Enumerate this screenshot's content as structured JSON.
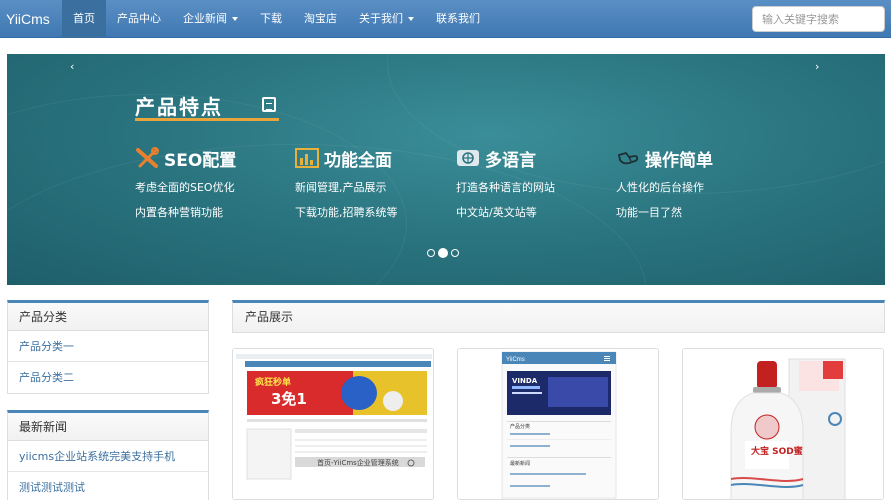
{
  "brand": "YiiCms",
  "nav": {
    "items": [
      {
        "label": "首页"
      },
      {
        "label": "产品中心"
      },
      {
        "label": "企业新闻"
      },
      {
        "label": "下载"
      },
      {
        "label": "淘宝店"
      },
      {
        "label": "关于我们"
      },
      {
        "label": "联系我们"
      }
    ]
  },
  "search": {
    "placeholder": "输入关键字搜索"
  },
  "banner": {
    "arrow_left": "‹",
    "arrow_right": "›",
    "title": "产品特点",
    "features": [
      {
        "title": "SEO配置",
        "line1": "考虑全面的SEO优化",
        "line2": "内置各种营销功能",
        "icon": "tools-icon"
      },
      {
        "title": "功能全面",
        "line1": "新闻管理,产品展示",
        "line2": "下载功能,招聘系统等",
        "icon": "bar-chart-icon"
      },
      {
        "title": "多语言",
        "line1": "打造各种语言的网站",
        "line2": "中文站/英文站等",
        "icon": "globe-icon"
      },
      {
        "title": "操作简单",
        "line1": "人性化的后台操作",
        "line2": "功能一目了然",
        "icon": "pointer-hand-icon"
      }
    ],
    "slides": 3,
    "active_slide": 1
  },
  "sidebar": {
    "categories": {
      "heading": "产品分类",
      "items": [
        {
          "label": "产品分类一"
        },
        {
          "label": "产品分类二"
        }
      ]
    },
    "news": {
      "heading": "最新新闻",
      "items": [
        {
          "label": "yiicms企业站系统完美支持手机"
        },
        {
          "label": "测试测试测试"
        }
      ]
    }
  },
  "products": {
    "heading": "产品展示",
    "thumbs": [
      {
        "name": "desktop-site-screenshot",
        "text1": "疯狂秒单",
        "text2": "3免1",
        "caption": "首页-YiiCms企业管理系统"
      },
      {
        "name": "mobile-site-screenshot",
        "brand": "YiiCms",
        "ad": "VINDA",
        "list1": "产品分类",
        "list2": "最新新闻"
      },
      {
        "name": "product-bottle-photo",
        "label": "大宝 SOD蜜"
      }
    ]
  },
  "colors": {
    "accent": "#4a86b8",
    "banner": "#2b7681",
    "underline": "#e9a53b"
  }
}
